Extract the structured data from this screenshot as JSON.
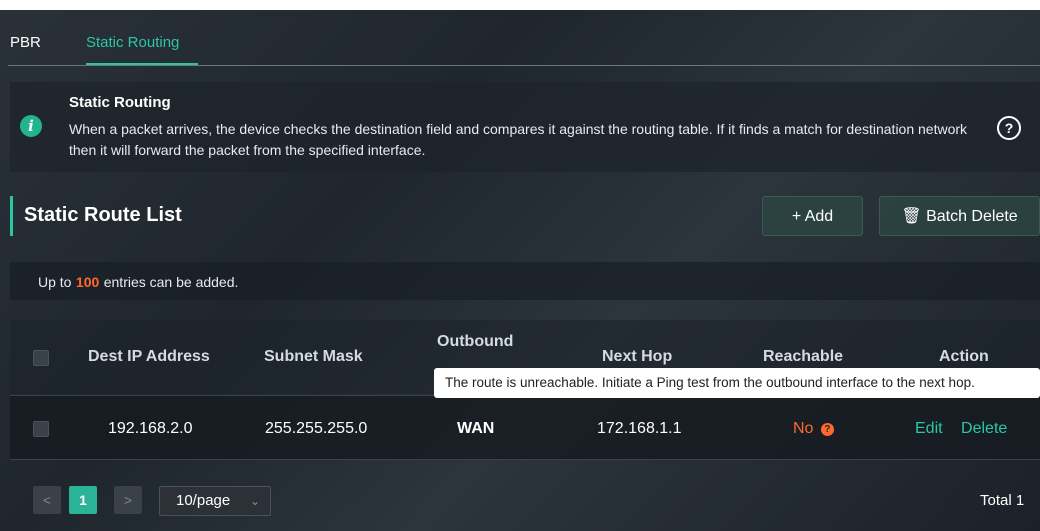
{
  "tabs": [
    {
      "label": "PBR"
    },
    {
      "label": "Static Routing"
    }
  ],
  "info": {
    "title": "Static Routing",
    "text": "When a packet arrives, the device checks the destination field and compares it against the routing table. If it finds a match for destination network then it will forward the packet from the specified interface.",
    "icon": "info-icon",
    "help_glyph": "?"
  },
  "list": {
    "title": "Static Route List",
    "add_label": "+ Add",
    "batch_delete_label": "🗑 Batch Delete",
    "note_prefix": "Up to",
    "note_count": "100",
    "note_suffix": "entries can be added."
  },
  "table": {
    "headers": [
      "Dest IP Address",
      "Subnet Mask",
      "Outbound",
      "Next Hop",
      "Reachable",
      "Action"
    ],
    "rows": [
      {
        "dest_ip": "192.168.2.0",
        "subnet_mask": "255.255.255.0",
        "outbound": "WAN",
        "next_hop": "172.168.1.1",
        "reachable": "No",
        "actions": [
          "Edit",
          "Delete"
        ]
      }
    ]
  },
  "tooltip": {
    "text": "The route is unreachable. Initiate a Ping test from the outbound interface to the next hop."
  },
  "pagination": {
    "prev": "<",
    "current_page": "1",
    "next": ">",
    "page_size": "10/page",
    "total": "Total 1"
  },
  "colors": {
    "accent": "#2bc6a4",
    "warning": "#ff6a2b",
    "background": "#2a3139"
  }
}
